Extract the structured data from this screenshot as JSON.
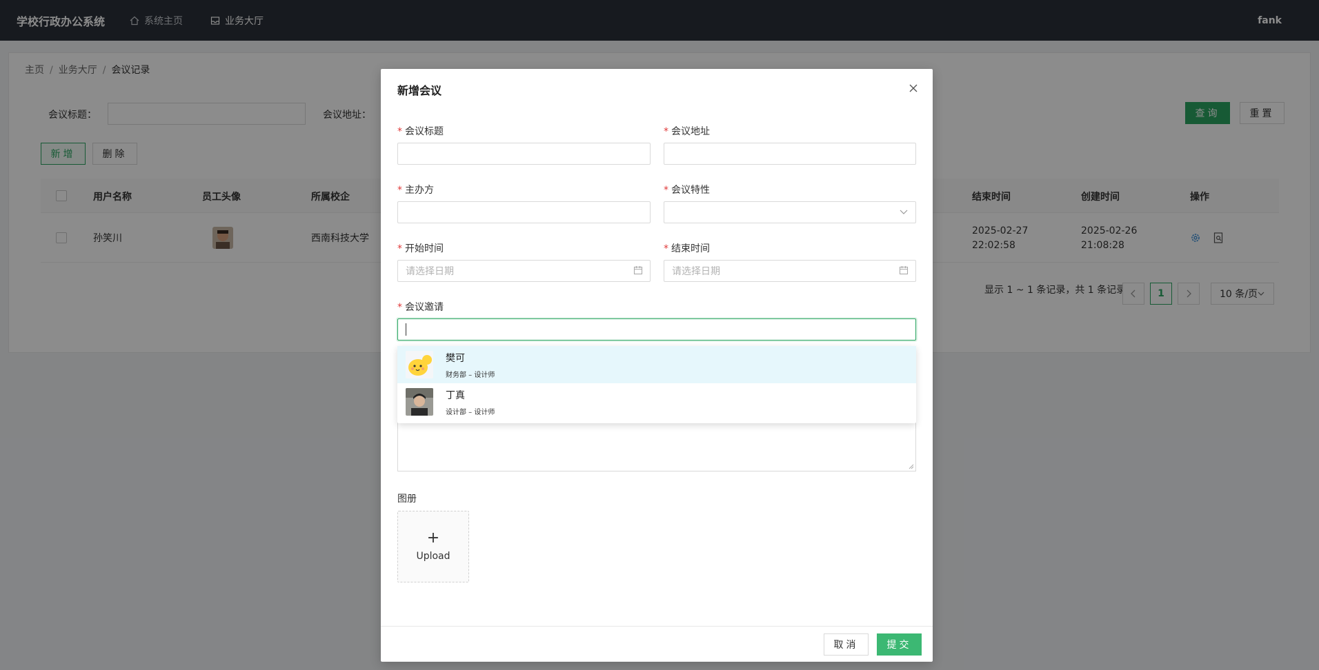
{
  "app": {
    "title": "学校行政办公系统",
    "user": "fank"
  },
  "nav": [
    {
      "label": "系统主页",
      "icon": "home-icon"
    },
    {
      "label": "业务大厅",
      "icon": "inbox-icon"
    }
  ],
  "breadcrumb": [
    "主页",
    "业务大厅",
    "会议记录"
  ],
  "filters": {
    "title_label": "会议标题：",
    "address_label": "会议地址：",
    "search_btn": "查询",
    "reset_btn": "重置"
  },
  "actions": {
    "add_btn": "新增",
    "delete_btn": "删除"
  },
  "table": {
    "headers": [
      "用户名称",
      "员工头像",
      "所属校企",
      "结束时间",
      "创建时间",
      "操作"
    ],
    "rows": [
      {
        "name": "孙笑川",
        "org": "西南科技大学",
        "end_date": "2025-02-27",
        "end_time": "22:02:58",
        "created_date": "2025-02-26",
        "created_time": "21:08:28"
      }
    ]
  },
  "pagination": {
    "summary": "显示 1 ~ 1 条记录，共 1 条记录",
    "current": "1",
    "page_size": "10 条/页"
  },
  "modal": {
    "title": "新增会议",
    "fields": {
      "title": "会议标题",
      "address": "会议地址",
      "organizer": "主办方",
      "nature": "会议特性",
      "start": "开始时间",
      "end": "结束时间",
      "invite": "会议邀请",
      "album": "图册"
    },
    "date_placeholder": "请选择日期",
    "invite_options": [
      {
        "name": "樊可",
        "desc": "财务部 – 设计师"
      },
      {
        "name": "丁真",
        "desc": "设计部 – 设计师"
      }
    ],
    "upload_label": "Upload",
    "cancel_btn": "取消",
    "submit_btn": "提交"
  },
  "colors": {
    "primary": "#2aa561",
    "nav_bg": "#2b3139",
    "required": "#e03a3a",
    "option_hover": "#e6f7fc"
  }
}
